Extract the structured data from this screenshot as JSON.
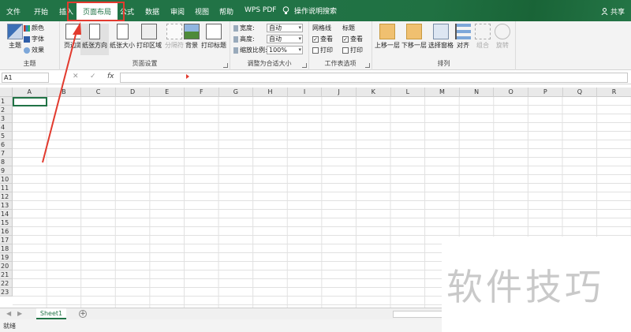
{
  "tabs": [
    "文件",
    "开始",
    "插入",
    "页面布局",
    "公式",
    "数据",
    "审阅",
    "视图",
    "帮助",
    "WPS PDF"
  ],
  "active_tab": "页面布局",
  "tell_me": "操作说明搜索",
  "share": "共享",
  "ribbon": {
    "themes": {
      "label": "主题",
      "big": "主题",
      "colors": "颜色",
      "fonts": "字体",
      "effects": "效果"
    },
    "page_setup": {
      "label": "页面设置",
      "margins": "页边距",
      "orientation": "纸张方向",
      "size": "纸张大小",
      "print_area": "打印区域",
      "breaks": "分隔符",
      "background": "背景",
      "print_titles": "打印标题"
    },
    "scale_to_fit": {
      "label": "调整为合适大小",
      "width_label": "宽度:",
      "width_value": "自动",
      "height_label": "高度:",
      "height_value": "自动",
      "scale_label": "缩放比例:",
      "scale_value": "100%"
    },
    "sheet_options": {
      "label": "工作表选项",
      "gridlines": "网格线",
      "headings": "标题",
      "view": "查看",
      "print": "打印"
    },
    "arrange": {
      "label": "排列",
      "bring_forward": "上移一层",
      "send_backward": "下移一层",
      "selection_pane": "选择窗格",
      "align": "对齐",
      "group": "组合",
      "rotate": "旋转"
    }
  },
  "formula_bar": {
    "name_box": "A1",
    "fx": "fx"
  },
  "columns": [
    "A",
    "B",
    "C",
    "D",
    "E",
    "F",
    "G",
    "H",
    "I",
    "J",
    "K",
    "L",
    "M",
    "N",
    "O",
    "P",
    "Q",
    "R"
  ],
  "rows": [
    "1",
    "2",
    "3",
    "4",
    "5",
    "6",
    "7",
    "8",
    "9",
    "10",
    "11",
    "12",
    "13",
    "14",
    "15",
    "16",
    "17",
    "18",
    "19",
    "20",
    "21",
    "22",
    "23"
  ],
  "sheet_tab": "Sheet1",
  "status": "就绪",
  "watermark": "软件技巧",
  "colors": {
    "brand_green": "#217346",
    "highlight_red": "#e23a2e"
  }
}
